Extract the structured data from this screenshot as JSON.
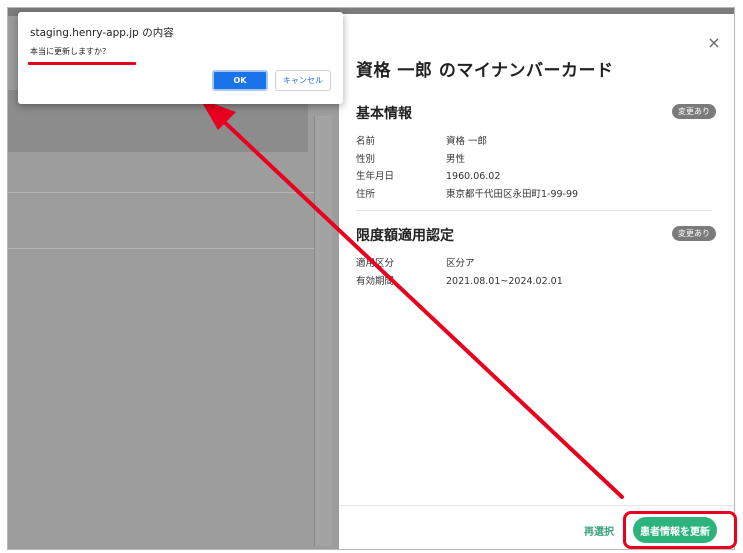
{
  "dialog": {
    "title": "staging.henry-app.jp の内容",
    "message": "本当に更新しますか？",
    "ok_label": "OK",
    "cancel_label": "キャンセル"
  },
  "panel": {
    "title": "資格 一郎 のマイナンバーカード",
    "close_icon": "×",
    "sections": [
      {
        "title": "基本情報",
        "badge": "変更あり",
        "rows": [
          {
            "label": "名前",
            "value": "資格 一郎"
          },
          {
            "label": "性別",
            "value": "男性"
          },
          {
            "label": "生年月日",
            "value": "1960.06.02"
          },
          {
            "label": "住所",
            "value": "東京都千代田区永田町1-99-99"
          }
        ]
      },
      {
        "title": "限度額適用認定",
        "badge": "変更あり",
        "rows": [
          {
            "label": "適用区分",
            "value": "区分ア"
          },
          {
            "label": "有効期間",
            "value": "2021.08.01~2024.02.01"
          }
        ]
      }
    ],
    "reselect_label": "再選択",
    "update_label": "患者情報を更新"
  },
  "colors": {
    "accent_green": "#2db37c",
    "annotation_red": "#e8001e",
    "dialog_blue": "#1a73e8"
  }
}
